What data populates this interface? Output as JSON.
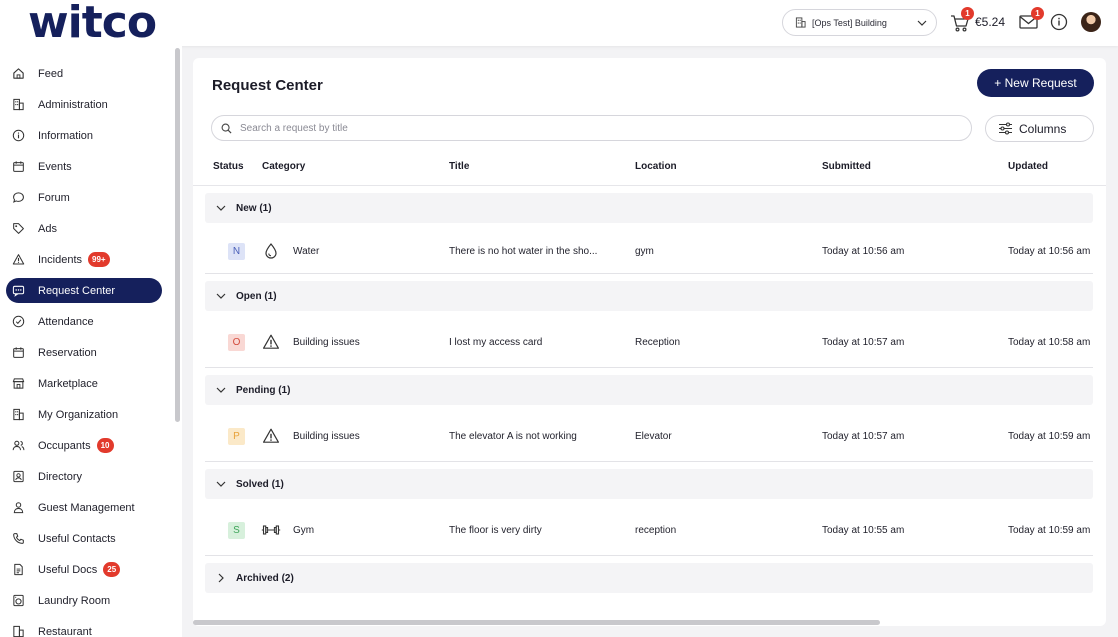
{
  "app": {
    "logo": "witco",
    "building": "[Ops Test] Building",
    "cart_count": "1",
    "balance": "€5.24",
    "mail_count": "1"
  },
  "sidebar": {
    "items": [
      {
        "label": "Feed",
        "icon": "home-icon"
      },
      {
        "label": "Administration",
        "icon": "building-icon"
      },
      {
        "label": "Information",
        "icon": "info-icon"
      },
      {
        "label": "Events",
        "icon": "calendar-icon"
      },
      {
        "label": "Forum",
        "icon": "chat-icon"
      },
      {
        "label": "Ads",
        "icon": "tag-icon"
      },
      {
        "label": "Incidents",
        "icon": "warning-icon",
        "badge": "99+"
      },
      {
        "label": "Request Center",
        "icon": "message-icon",
        "active": true
      },
      {
        "label": "Attendance",
        "icon": "check-circle-icon"
      },
      {
        "label": "Reservation",
        "icon": "calendar-icon"
      },
      {
        "label": "Marketplace",
        "icon": "store-icon"
      },
      {
        "label": "My Organization",
        "icon": "building-icon"
      },
      {
        "label": "Occupants",
        "icon": "users-icon",
        "badge": "10"
      },
      {
        "label": "Directory",
        "icon": "contact-icon"
      },
      {
        "label": "Guest Management",
        "icon": "guest-icon"
      },
      {
        "label": "Useful Contacts",
        "icon": "phone-icon"
      },
      {
        "label": "Useful Docs",
        "icon": "document-icon",
        "badge": "25"
      },
      {
        "label": "Laundry Room",
        "icon": "washer-icon"
      },
      {
        "label": "Restaurant",
        "icon": "building-icon"
      }
    ]
  },
  "main": {
    "title": "Request Center",
    "new_button": "+ New Request",
    "search_placeholder": "Search a request by title",
    "columns_button": "Columns",
    "headers": {
      "status": "Status",
      "category": "Category",
      "title": "Title",
      "location": "Location",
      "submitted": "Submitted",
      "updated": "Updated"
    },
    "groups": {
      "new": "New (1)",
      "open": "Open (1)",
      "pending": "Pending (1)",
      "solved": "Solved (1)",
      "archived": "Archived (2)"
    },
    "rows": [
      {
        "status": "N",
        "category": "Water",
        "category_icon": "droplet-icon",
        "title": "There is no hot water in the sho...",
        "location": "gym",
        "submitted": "Today at 10:56 am",
        "updated": "Today at 10:56 am"
      },
      {
        "status": "O",
        "category": "Building issues",
        "category_icon": "warning-icon",
        "title": "I lost my access card",
        "location": "Reception",
        "submitted": "Today at 10:57 am",
        "updated": "Today at 10:58 am"
      },
      {
        "status": "P",
        "category": "Building issues",
        "category_icon": "warning-icon",
        "title": "The elevator A is not working",
        "location": "Elevator",
        "submitted": "Today at 10:57 am",
        "updated": "Today at 10:59 am"
      },
      {
        "status": "S",
        "category": "Gym",
        "category_icon": "dumbbell-icon",
        "title": "The floor is very dirty",
        "location": "reception",
        "submitted": "Today at 10:55 am",
        "updated": "Today at 10:59 am"
      }
    ]
  },
  "colors": {
    "brand": "#15205c",
    "badge": "#e23a2c",
    "status_new_bg": "#dde3f7",
    "status_new_fg": "#4a5fb8",
    "status_open_bg": "#f9d8d4",
    "status_open_fg": "#d34a3c",
    "status_pending_bg": "#fbe9c8",
    "status_pending_fg": "#e8a33b",
    "status_solved_bg": "#d7f0dc",
    "status_solved_fg": "#3fa55a"
  }
}
